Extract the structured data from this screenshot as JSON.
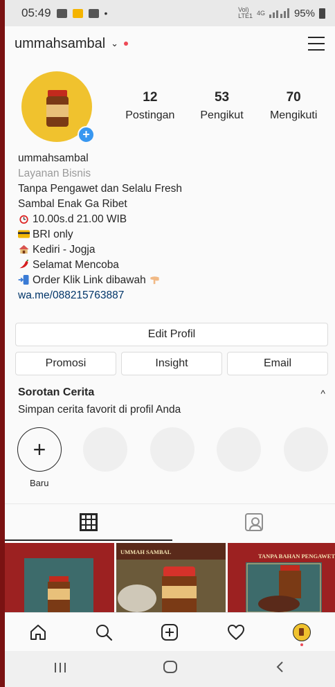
{
  "status_bar": {
    "time": "05:49",
    "dot": "•",
    "net_top": "Vol)",
    "net_bottom": "LTE1",
    "lte": "4G",
    "battery": "95%"
  },
  "header": {
    "username": "ummahsambal"
  },
  "stats": [
    {
      "value": "12",
      "label": "Postingan"
    },
    {
      "value": "53",
      "label": "Pengikut"
    },
    {
      "value": "70",
      "label": "Mengikuti"
    }
  ],
  "bio": {
    "name": "ummahsambal",
    "category": "Layanan Bisnis",
    "lines": [
      "Tanpa Pengawet dan Selalu Fresh",
      "Sambal Enak Ga Ribet",
      "10.00s.d 21.00 WIB",
      "BRI only",
      "Kediri - Jogja",
      "Selamat Mencoba",
      "Order Klik Link dibawah"
    ],
    "link": "wa.me/088215763887"
  },
  "buttons": {
    "edit": "Edit Profil",
    "promo": "Promosi",
    "insight": "Insight",
    "email": "Email"
  },
  "highlights": {
    "title": "Sorotan Cerita",
    "subtitle": "Simpan cerita favorit di profil Anda",
    "new_label": "Baru"
  },
  "posts": {
    "caption_2": "UMMAH SAMBAL",
    "caption_3": "TANPA BAHAN PENGAWET"
  },
  "icons": [
    "chevron-down-icon",
    "menu-icon",
    "plus-icon",
    "grid-icon",
    "tagged-icon",
    "home-icon",
    "search-icon",
    "add-post-icon",
    "heart-icon",
    "profile-icon"
  ],
  "colors": {
    "accent": "#3897f0",
    "link": "#003569",
    "notification": "#ed4956",
    "avatar_bg": "#f0c22e",
    "frame": "#7a1212"
  }
}
